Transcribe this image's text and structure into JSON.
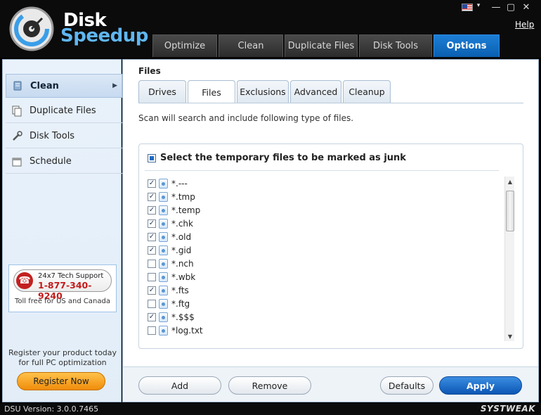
{
  "app": {
    "brand_line1": "Disk",
    "brand_line2": "Speedup",
    "help_label": "Help"
  },
  "window_controls": {
    "minimize": "—",
    "maximize": "▢",
    "close": "✕",
    "flag_dropdown": "▾"
  },
  "top_tabs": [
    {
      "label": "Optimize"
    },
    {
      "label": "Clean"
    },
    {
      "label": "Duplicate Files"
    },
    {
      "label": "Disk Tools"
    },
    {
      "label": "Options"
    }
  ],
  "sidebar": {
    "items": [
      {
        "label": "Clean"
      },
      {
        "label": "Duplicate Files"
      },
      {
        "label": "Disk Tools"
      },
      {
        "label": "Schedule"
      }
    ],
    "support": {
      "line1": "24x7 Tech Support",
      "phone": "1-877-340-9240",
      "footer": "Toll free for US and Canada"
    },
    "register_text_1": "Register your product today",
    "register_text_2": "for full PC optimization",
    "register_button": "Register Now"
  },
  "main": {
    "section_title": "Files",
    "sub_tabs": [
      {
        "label": "Drives"
      },
      {
        "label": "Files"
      },
      {
        "label": "Exclusions"
      },
      {
        "label": "Advanced"
      },
      {
        "label": "Cleanup"
      }
    ],
    "description": "Scan will search and include following type of files.",
    "list_heading": "Select the temporary files to be marked as junk",
    "files": [
      {
        "name": "*.---",
        "checked": true
      },
      {
        "name": "*.tmp",
        "checked": true
      },
      {
        "name": "*.temp",
        "checked": true
      },
      {
        "name": "*.chk",
        "checked": true
      },
      {
        "name": "*.old",
        "checked": true
      },
      {
        "name": "*.gid",
        "checked": true
      },
      {
        "name": "*.nch",
        "checked": false
      },
      {
        "name": "*.wbk",
        "checked": false
      },
      {
        "name": "*.fts",
        "checked": true
      },
      {
        "name": "*.ftg",
        "checked": false
      },
      {
        "name": "*.$$$",
        "checked": true
      },
      {
        "name": "*log.txt",
        "checked": false
      }
    ],
    "buttons": {
      "add": "Add",
      "remove": "Remove",
      "defaults": "Defaults",
      "apply": "Apply"
    }
  },
  "status": {
    "version": "DSU Version: 3.0.0.7465",
    "company": "SYSTWEAK"
  }
}
